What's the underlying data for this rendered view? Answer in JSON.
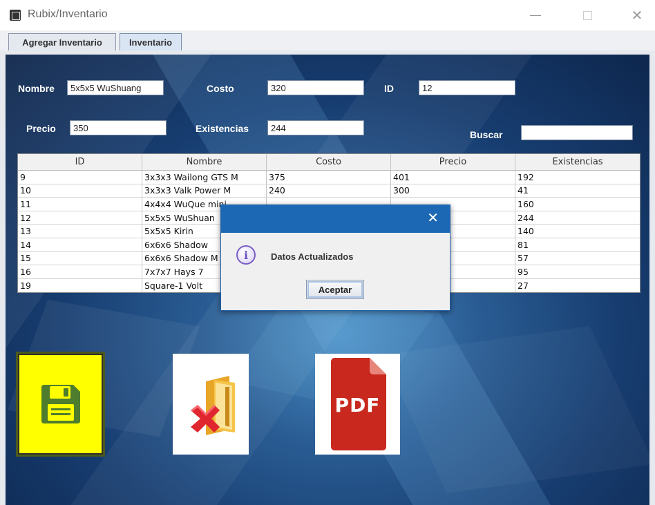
{
  "window": {
    "title": "Rubix/Inventario",
    "close_glyph": "✕"
  },
  "tabs": [
    {
      "label": "Agregar Inventario"
    },
    {
      "label": "Inventario"
    }
  ],
  "form": {
    "nombre_label": "Nombre",
    "nombre_value": "5x5x5 WuShuang",
    "costo_label": "Costo",
    "costo_value": "320",
    "id_label": "ID",
    "id_value": "12",
    "precio_label": "Precio",
    "precio_value": "350",
    "existencias_label": "Existencias",
    "existencias_value": "244",
    "buscar_label": "Buscar",
    "buscar_value": ""
  },
  "table": {
    "headers": [
      "ID",
      "Nombre",
      "Costo",
      "Precio",
      "Existencias"
    ],
    "rows": [
      [
        "9",
        "3x3x3 Wailong GTS M",
        "375",
        "401",
        "192"
      ],
      [
        "10",
        "3x3x3 Valk Power M",
        "240",
        "300",
        "41"
      ],
      [
        "11",
        "4x4x4 WuQue mini",
        "",
        "",
        "160"
      ],
      [
        "12",
        "5x5x5 WuShuan",
        "",
        "",
        "244"
      ],
      [
        "13",
        "5x5x5 Kirin",
        "",
        "",
        "140"
      ],
      [
        "14",
        "6x6x6 Shadow",
        "",
        "",
        "81"
      ],
      [
        "15",
        "6x6x6 Shadow M",
        "",
        "",
        "57"
      ],
      [
        "16",
        "7x7x7 Hays 7",
        "",
        "",
        "95"
      ],
      [
        "19",
        "Square-1 Volt",
        "",
        "",
        "27"
      ]
    ]
  },
  "dialog": {
    "close_glyph": "✕",
    "info_glyph": "i",
    "message": "Datos Actualizados",
    "button_label": "Aceptar"
  },
  "actions": {
    "pdf_label": "PDF"
  },
  "colors": {
    "save_tile": "#ffff00",
    "save_icon": "#4e7d2d",
    "delete_x": "#e0262e",
    "pdf_red": "#c8281e",
    "dialog_title": "#1d68b4"
  }
}
